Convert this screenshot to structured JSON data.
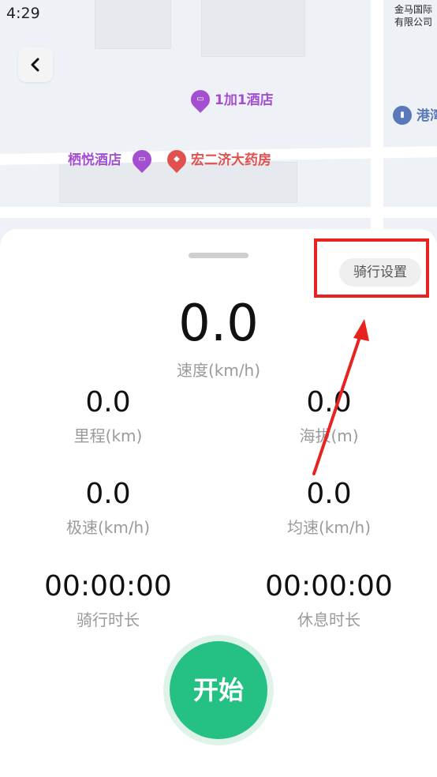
{
  "status_bar": {
    "time": "4:29",
    "right_text_1": "金马国际",
    "right_text_2": "有限公司"
  },
  "map": {
    "pois": [
      {
        "label": "1加1酒店",
        "icon": "hotel-icon",
        "color": "#a44fd1"
      },
      {
        "label": "港湾",
        "icon": "building-icon",
        "color": "#5b79b8"
      },
      {
        "label": "栖悦酒店",
        "icon": "hotel-icon",
        "color": "#a44fd1"
      },
      {
        "label": "宏二济大药房",
        "icon": "pharmacy-icon",
        "color": "#e0524f"
      }
    ]
  },
  "panel": {
    "settings_label": "骑行设置",
    "speed": {
      "value": "0.0",
      "label": "速度(km/h)"
    },
    "mileage": {
      "value": "0.0",
      "label": "里程(km)"
    },
    "altitude": {
      "value": "0.0",
      "label": "海拔(m)"
    },
    "max_speed": {
      "value": "0.0",
      "label": "极速(km/h)"
    },
    "avg_speed": {
      "value": "0.0",
      "label": "均速(km/h)"
    },
    "ride_duration": {
      "value": "00:00:00",
      "label": "骑行时长"
    },
    "rest_duration": {
      "value": "00:00:00",
      "label": "休息时长"
    },
    "start_label": "开始"
  },
  "colors": {
    "accent": "#25c083",
    "highlight": "#e8231f"
  }
}
